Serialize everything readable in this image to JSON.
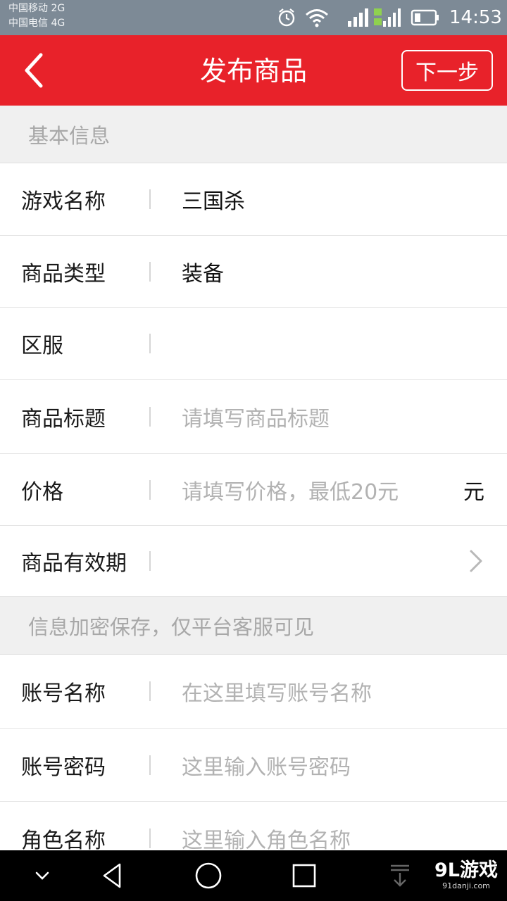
{
  "status_bar": {
    "carrier_1": "中国移动 2G",
    "carrier_2": "中国电信 4G",
    "icons": [
      "alarm-clock-icon",
      "wifi-icon",
      "signal-icon",
      "signal-4g-2g-icon",
      "battery-icon"
    ],
    "time": "14:53"
  },
  "header": {
    "back_icon": "chevron-left-icon",
    "title": "发布商品",
    "next_label": "下一步",
    "background_color": "#e8222a"
  },
  "basic_section": {
    "title": "基本信息",
    "rows": [
      {
        "label": "游戏名称",
        "value": "三国杀"
      },
      {
        "label": "商品类型",
        "value": "装备"
      },
      {
        "label": "区服",
        "value": ""
      },
      {
        "label": "商品标题",
        "placeholder": "请填写商品标题"
      },
      {
        "label": "价格",
        "placeholder": "请填写价格，最低20元",
        "suffix": "元"
      },
      {
        "label": "商品有效期",
        "value": "",
        "icon": "chevron-right-icon"
      }
    ]
  },
  "secure_section": {
    "title": "信息加密保存，仅平台客服可见",
    "rows": [
      {
        "label": "账号名称",
        "placeholder": "在这里填写账号名称"
      },
      {
        "label": "账号密码",
        "placeholder": "这里输入账号密码"
      },
      {
        "label": "角色名称",
        "placeholder": "这里输入角色名称"
      }
    ]
  },
  "nav_bar": {
    "icons": [
      "hide-keyboard-icon",
      "back-triangle-icon",
      "home-circle-icon",
      "recent-square-icon",
      "pull-down-icon"
    ]
  },
  "watermark": {
    "logo": "9L游戏",
    "url": "91danji.com"
  }
}
